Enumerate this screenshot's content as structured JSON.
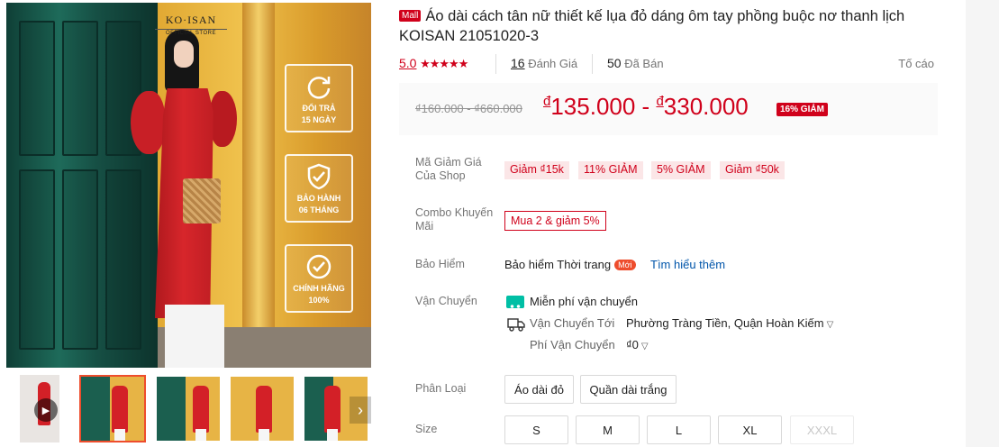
{
  "gallery": {
    "brand_logo": "KO·ISAN",
    "brand_sub": "OFFICIAL STORE",
    "badges": [
      {
        "icon": "return-icon",
        "line1": "ĐỔI TRẢ",
        "line2": "15 NGÀY"
      },
      {
        "icon": "shield-check-icon",
        "line1": "BẢO HÀNH",
        "line2": "06 THÁNG"
      },
      {
        "icon": "check-circle-icon",
        "line1": "CHÍNH HÃNG",
        "line2": "100%"
      }
    ],
    "next_arrow": "›"
  },
  "product": {
    "mall_tag": "Mall",
    "title": "Áo dài cách tân nữ thiết kế lụa đỏ dáng ôm tay phồng buộc nơ thanh lịch KOISAN 21051020-3",
    "rating": "5.0",
    "stars": "★★★★★",
    "reviews_count": "16",
    "reviews_label": "Đánh Giá",
    "sold_count": "50",
    "sold_label": "Đã Bán",
    "report": "Tố cáo"
  },
  "price": {
    "old": "₫160.000 - ₫660.000",
    "currency": "đ",
    "low": "135.000",
    "sep": " - ",
    "high": "330.000",
    "discount": "16% GIẢM"
  },
  "vouchers": {
    "label": "Mã Giảm Giá Của Shop",
    "items": [
      "Giảm ₫15k",
      "11% GIẢM",
      "5% GIẢM",
      "Giảm ₫50k"
    ]
  },
  "combo": {
    "label": "Combo Khuyến Mãi",
    "value": "Mua 2 & giảm 5%"
  },
  "insurance": {
    "label": "Bảo Hiểm",
    "value": "Bảo hiểm Thời trang",
    "badge": "Mới",
    "link": "Tìm hiểu thêm"
  },
  "shipping": {
    "label": "Vận Chuyển",
    "free": "Miễn phí vận chuyển",
    "to_label": "Vận Chuyển Tới",
    "to_value": "Phường Tràng Tiền, Quận Hoàn Kiếm",
    "fee_label": "Phí Vận Chuyển",
    "fee_value": "₫0"
  },
  "variation": {
    "label": "Phân Loại",
    "options": [
      "Áo dài đỏ",
      "Quần dài trắng"
    ]
  },
  "size": {
    "label": "Size",
    "options": [
      "S",
      "M",
      "L",
      "XL",
      "XXXL"
    ],
    "disabled": "XXXL"
  },
  "colors": {
    "accent": "#d0011b",
    "voucher_bg": "#fbe6e7",
    "link": "#0055aa"
  }
}
